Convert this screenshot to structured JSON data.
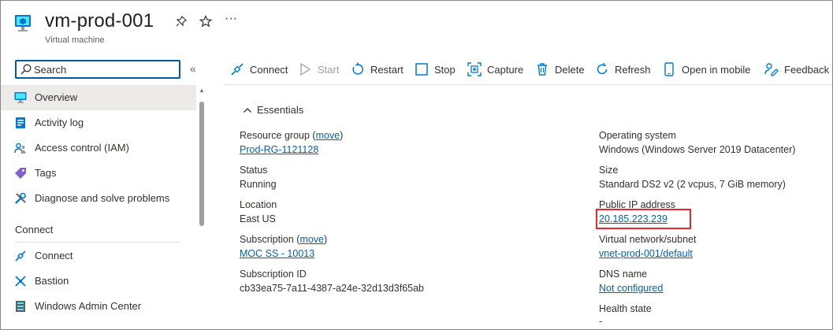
{
  "header": {
    "title": "vm-prod-001",
    "subtitle": "Virtual machine",
    "icon": "virtual-machine-icon",
    "actions": {
      "pin": "pin-icon",
      "favorite": "star-icon",
      "more": "···"
    }
  },
  "sidebar": {
    "search_placeholder": "Search",
    "collapse_glyph": "«",
    "items": [
      {
        "label": "Overview",
        "icon": "monitor-icon",
        "active": true
      },
      {
        "label": "Activity log",
        "icon": "activity-log-icon"
      },
      {
        "label": "Access control (IAM)",
        "icon": "people-icon"
      },
      {
        "label": "Tags",
        "icon": "tag-icon"
      },
      {
        "label": "Diagnose and solve problems",
        "icon": "wrench-icon"
      }
    ],
    "section": "Connect",
    "connect_items": [
      {
        "label": "Connect",
        "icon": "plug-icon"
      },
      {
        "label": "Bastion",
        "icon": "bastion-icon"
      },
      {
        "label": "Windows Admin Center",
        "icon": "admin-center-icon"
      }
    ]
  },
  "toolbar": {
    "connect": "Connect",
    "start": "Start",
    "restart": "Restart",
    "stop": "Stop",
    "capture": "Capture",
    "delete": "Delete",
    "refresh": "Refresh",
    "open_mobile": "Open in mobile",
    "feedback": "Feedback"
  },
  "essentials": {
    "heading": "Essentials",
    "left": {
      "resource_group_label": "Resource group (",
      "resource_group_move": "move",
      "resource_group_close": ")",
      "resource_group_value": "Prod-RG-1121128",
      "status_label": "Status",
      "status_value": "Running",
      "location_label": "Location",
      "location_value": "East US",
      "subscription_label": "Subscription (",
      "subscription_move": "move",
      "subscription_close": ")",
      "subscription_value": "MOC SS - 10013",
      "subscription_id_label": "Subscription ID",
      "subscription_id_value": "cb33ea75-7a11-4387-a24e-32d13d3f65ab"
    },
    "right": {
      "os_label": "Operating system",
      "os_value": "Windows (Windows Server 2019 Datacenter)",
      "size_label": "Size",
      "size_value": "Standard DS2 v2 (2 vcpus, 7 GiB memory)",
      "public_ip_label": "Public IP address",
      "public_ip_value": "20.185.223.239",
      "vnet_label": "Virtual network/subnet",
      "vnet_value": "vnet-prod-001/default",
      "dns_label": "DNS name",
      "dns_value": "Not configured",
      "health_label": "Health state",
      "health_value": "-"
    }
  },
  "colors": {
    "accent": "#0078d4",
    "link": "#0062ad",
    "highlight": "#e8262b"
  }
}
